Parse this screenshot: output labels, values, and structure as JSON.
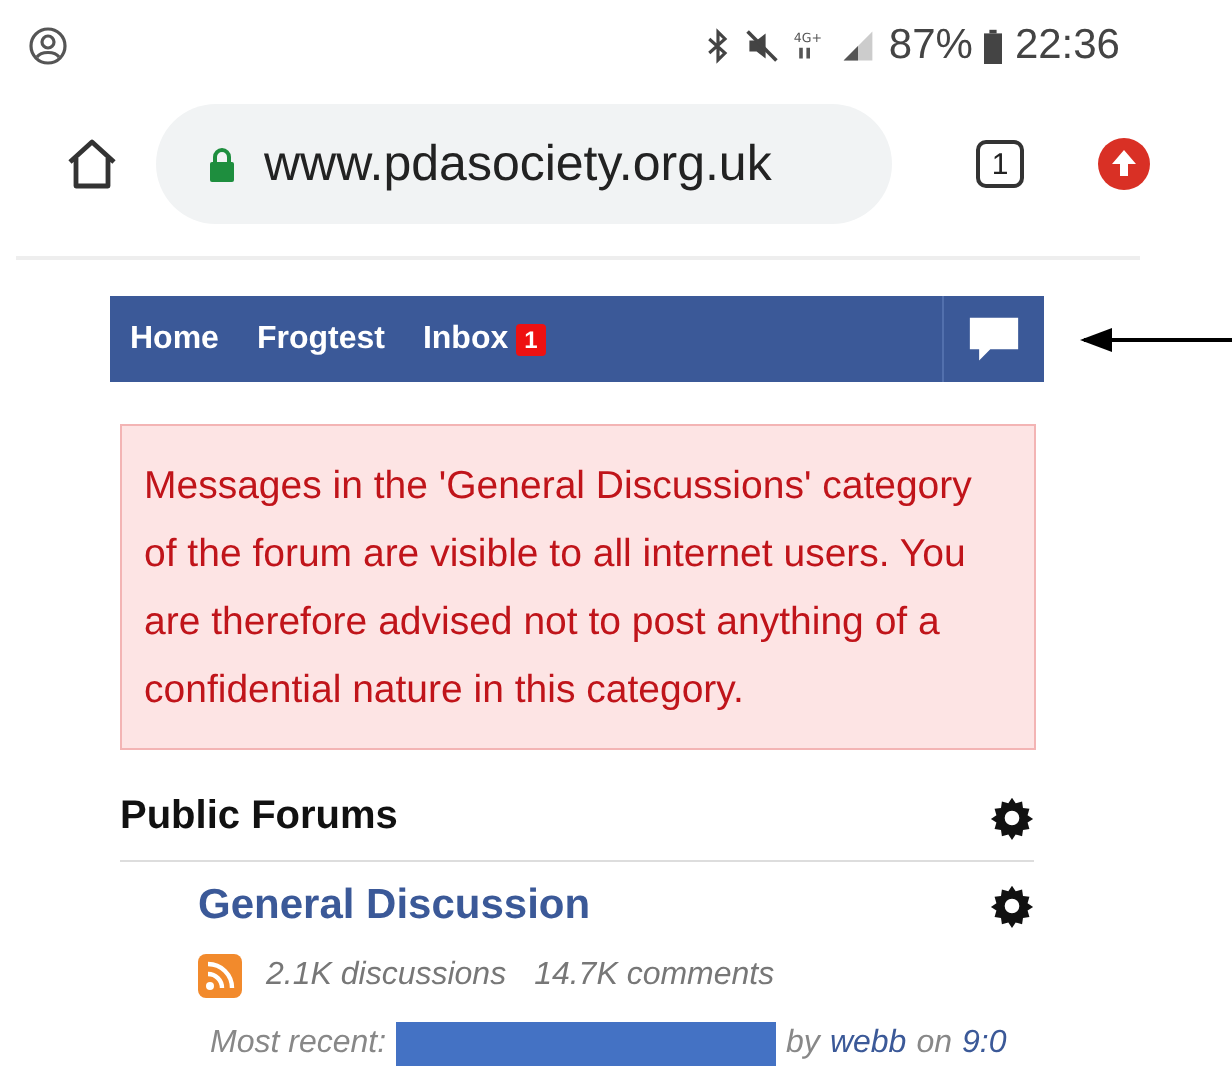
{
  "status_bar": {
    "network": "4G+",
    "battery": "87%",
    "time": "22:36"
  },
  "browser": {
    "url": "www.pdasociety.org.uk",
    "tab_count": "1"
  },
  "nav": {
    "items": [
      {
        "label": "Home"
      },
      {
        "label": "Frogtest"
      },
      {
        "label": "Inbox",
        "badge": "1"
      }
    ]
  },
  "alert": {
    "text": "Messages in the 'General Discussions' category of the forum are visible to all internet users. You are therefore advised not to post anything of a confidential nature in this category."
  },
  "section": {
    "title": "Public Forums"
  },
  "forum": {
    "title": "General Discussion",
    "discussions": "2.1K discussions",
    "comments": "14.7K comments",
    "recent_label": "Most recent:",
    "by": "by",
    "author": "webb",
    "on": "on",
    "time": "9:0"
  }
}
